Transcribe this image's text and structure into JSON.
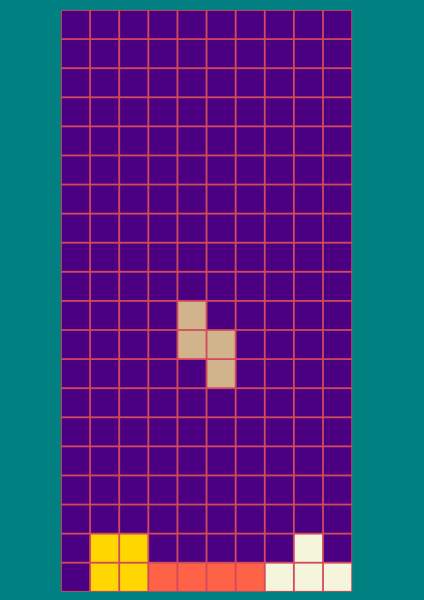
{
  "board": {
    "columns": 10,
    "rows": 20,
    "colors": {
      "background": "#4b0082",
      "grid_line": "#d1495b",
      "page": "#008080"
    }
  },
  "locked_cells": [
    {
      "row": 18,
      "col": 1,
      "color": "#ffd700",
      "piece": "O"
    },
    {
      "row": 18,
      "col": 2,
      "color": "#ffd700",
      "piece": "O"
    },
    {
      "row": 19,
      "col": 1,
      "color": "#ffd700",
      "piece": "O"
    },
    {
      "row": 19,
      "col": 2,
      "color": "#ffd700",
      "piece": "O"
    },
    {
      "row": 19,
      "col": 3,
      "color": "#ff6347",
      "piece": "I"
    },
    {
      "row": 19,
      "col": 4,
      "color": "#ff6347",
      "piece": "I"
    },
    {
      "row": 19,
      "col": 5,
      "color": "#ff6347",
      "piece": "I"
    },
    {
      "row": 19,
      "col": 6,
      "color": "#ff6347",
      "piece": "I"
    },
    {
      "row": 18,
      "col": 8,
      "color": "#f5f5dc",
      "piece": "T"
    },
    {
      "row": 19,
      "col": 7,
      "color": "#f5f5dc",
      "piece": "T"
    },
    {
      "row": 19,
      "col": 8,
      "color": "#f5f5dc",
      "piece": "T"
    },
    {
      "row": 19,
      "col": 9,
      "color": "#f5f5dc",
      "piece": "T"
    }
  ],
  "active_piece": {
    "type": "S",
    "color": "#d2b48c",
    "cells": [
      {
        "row": 10,
        "col": 4
      },
      {
        "row": 11,
        "col": 4
      },
      {
        "row": 11,
        "col": 5
      },
      {
        "row": 12,
        "col": 5
      }
    ]
  }
}
